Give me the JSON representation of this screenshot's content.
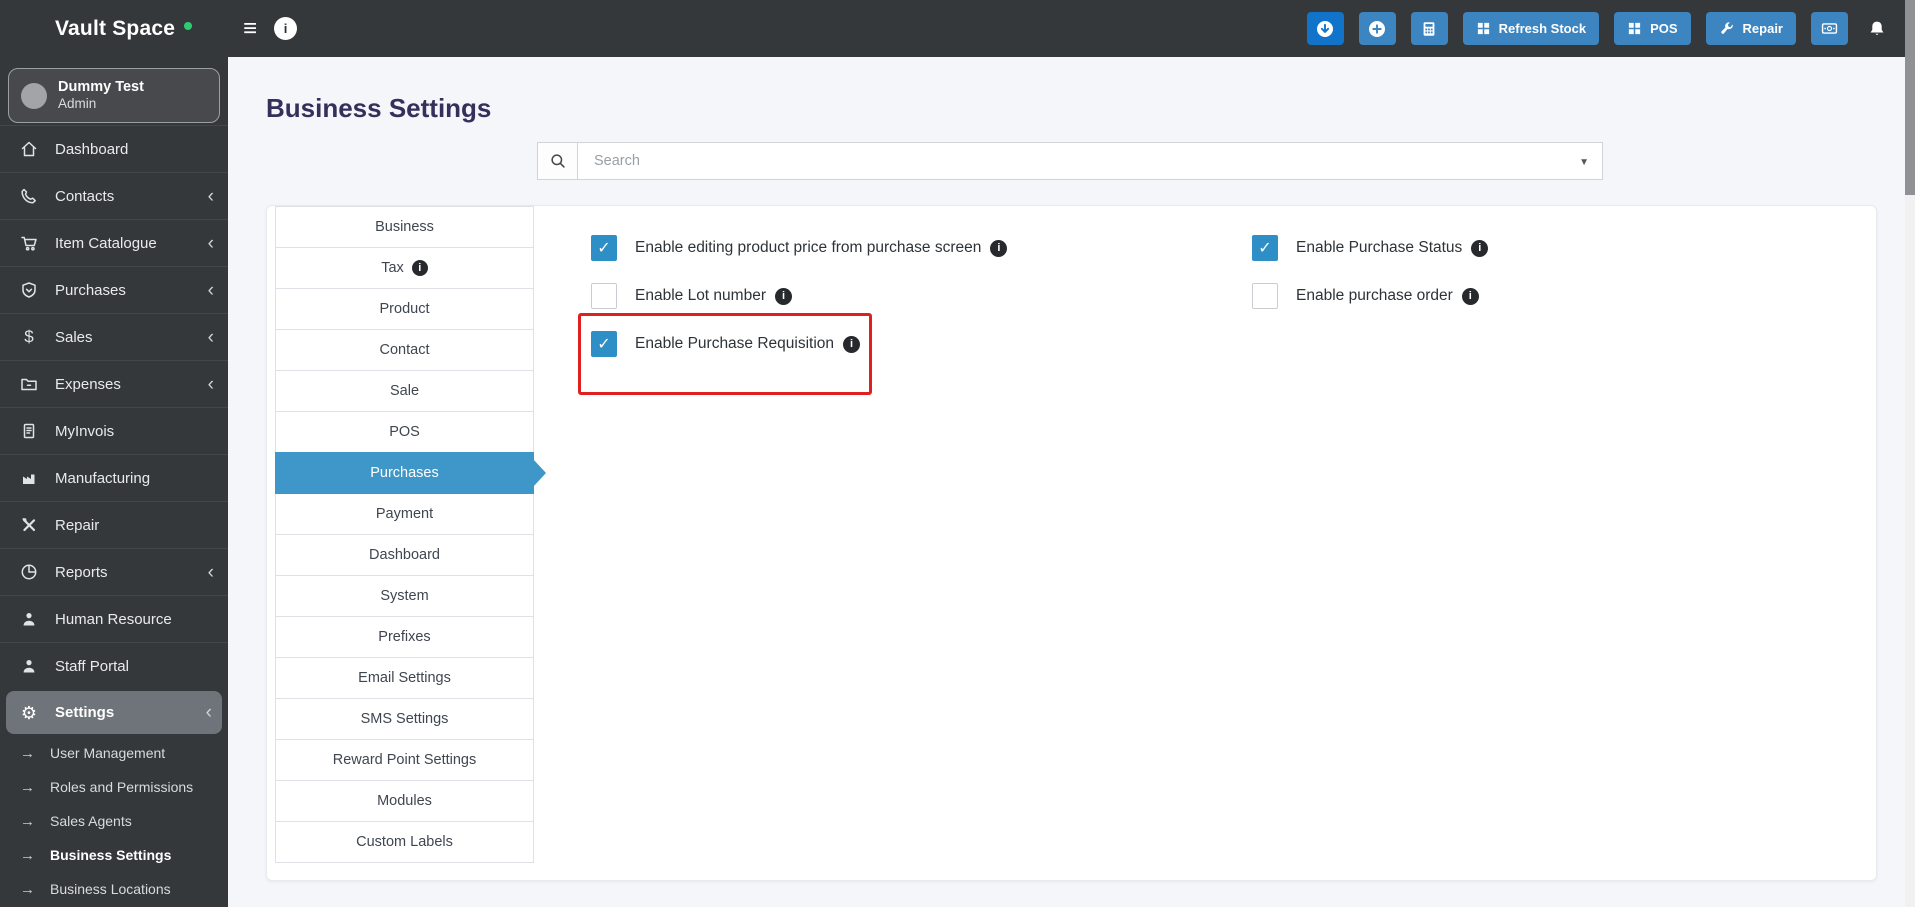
{
  "navbar": {
    "brand": "Vault Space",
    "refresh_stock": "Refresh Stock",
    "pos": "POS",
    "repair": "Repair"
  },
  "sidebar": {
    "user_name": "Dummy Test",
    "user_role": "Admin",
    "items": [
      {
        "label": "Dashboard",
        "icon": "home",
        "chevron": false,
        "active": false
      },
      {
        "label": "Contacts",
        "icon": "phone",
        "chevron": true,
        "active": false
      },
      {
        "label": "Item Catalogue",
        "icon": "cart",
        "chevron": true,
        "active": false
      },
      {
        "label": "Purchases",
        "icon": "shield",
        "chevron": true,
        "active": false
      },
      {
        "label": "Sales",
        "icon": "dollar",
        "chevron": true,
        "active": false
      },
      {
        "label": "Expenses",
        "icon": "folder",
        "chevron": true,
        "active": false
      },
      {
        "label": "MyInvois",
        "icon": "invoice",
        "chevron": false,
        "active": false
      },
      {
        "label": "Manufacturing",
        "icon": "factory",
        "chevron": false,
        "active": false
      },
      {
        "label": "Repair",
        "icon": "tools",
        "chevron": false,
        "active": false
      },
      {
        "label": "Reports",
        "icon": "pie",
        "chevron": true,
        "active": false
      },
      {
        "label": "Human Resource",
        "icon": "person",
        "chevron": false,
        "active": false
      },
      {
        "label": "Staff Portal",
        "icon": "person",
        "chevron": false,
        "active": false
      },
      {
        "label": "Settings",
        "icon": "gear",
        "chevron": true,
        "active": true
      }
    ],
    "settings_children": [
      {
        "label": "User Management",
        "active": false
      },
      {
        "label": "Roles and Permissions",
        "active": false
      },
      {
        "label": "Sales Agents",
        "active": false
      },
      {
        "label": "Business Settings",
        "active": true
      },
      {
        "label": "Business Locations",
        "active": false
      }
    ]
  },
  "main": {
    "title": "Business Settings",
    "search_placeholder": "Search",
    "tabs": [
      {
        "label": "Business",
        "active": false,
        "info": false
      },
      {
        "label": "Tax",
        "active": false,
        "info": true
      },
      {
        "label": "Product",
        "active": false,
        "info": false
      },
      {
        "label": "Contact",
        "active": false,
        "info": false
      },
      {
        "label": "Sale",
        "active": false,
        "info": false
      },
      {
        "label": "POS",
        "active": false,
        "info": false
      },
      {
        "label": "Purchases",
        "active": true,
        "info": false
      },
      {
        "label": "Payment",
        "active": false,
        "info": false
      },
      {
        "label": "Dashboard",
        "active": false,
        "info": false
      },
      {
        "label": "System",
        "active": false,
        "info": false
      },
      {
        "label": "Prefixes",
        "active": false,
        "info": false
      },
      {
        "label": "Email Settings",
        "active": false,
        "info": false
      },
      {
        "label": "SMS Settings",
        "active": false,
        "info": false
      },
      {
        "label": "Reward Point Settings",
        "active": false,
        "info": false
      },
      {
        "label": "Modules",
        "active": false,
        "info": false
      },
      {
        "label": "Custom Labels",
        "active": false,
        "info": false
      }
    ],
    "options_left": [
      {
        "label": "Enable editing product price from purchase screen",
        "checked": true,
        "info": true,
        "highlighted": false
      },
      {
        "label": "Enable Lot number",
        "checked": false,
        "info": true,
        "highlighted": false
      },
      {
        "label": "Enable Purchase Requisition",
        "checked": true,
        "info": true,
        "highlighted": true
      }
    ],
    "options_right": [
      {
        "label": "Enable Purchase Status",
        "checked": true,
        "info": true,
        "highlighted": false
      },
      {
        "label": "Enable purchase order",
        "checked": false,
        "info": true,
        "highlighted": false
      }
    ]
  },
  "colors": {
    "navbar_bg": "#35383b",
    "active_tab_blue": "#3e97c8",
    "checkbox_blue": "#2e8fc6",
    "button_blue": "#3d85c0",
    "button_blue_dark": "#1173c9",
    "highlight_red": "#e01f1f",
    "heading_navy": "#33305c",
    "brand_dot_green": "#2ecc71"
  }
}
